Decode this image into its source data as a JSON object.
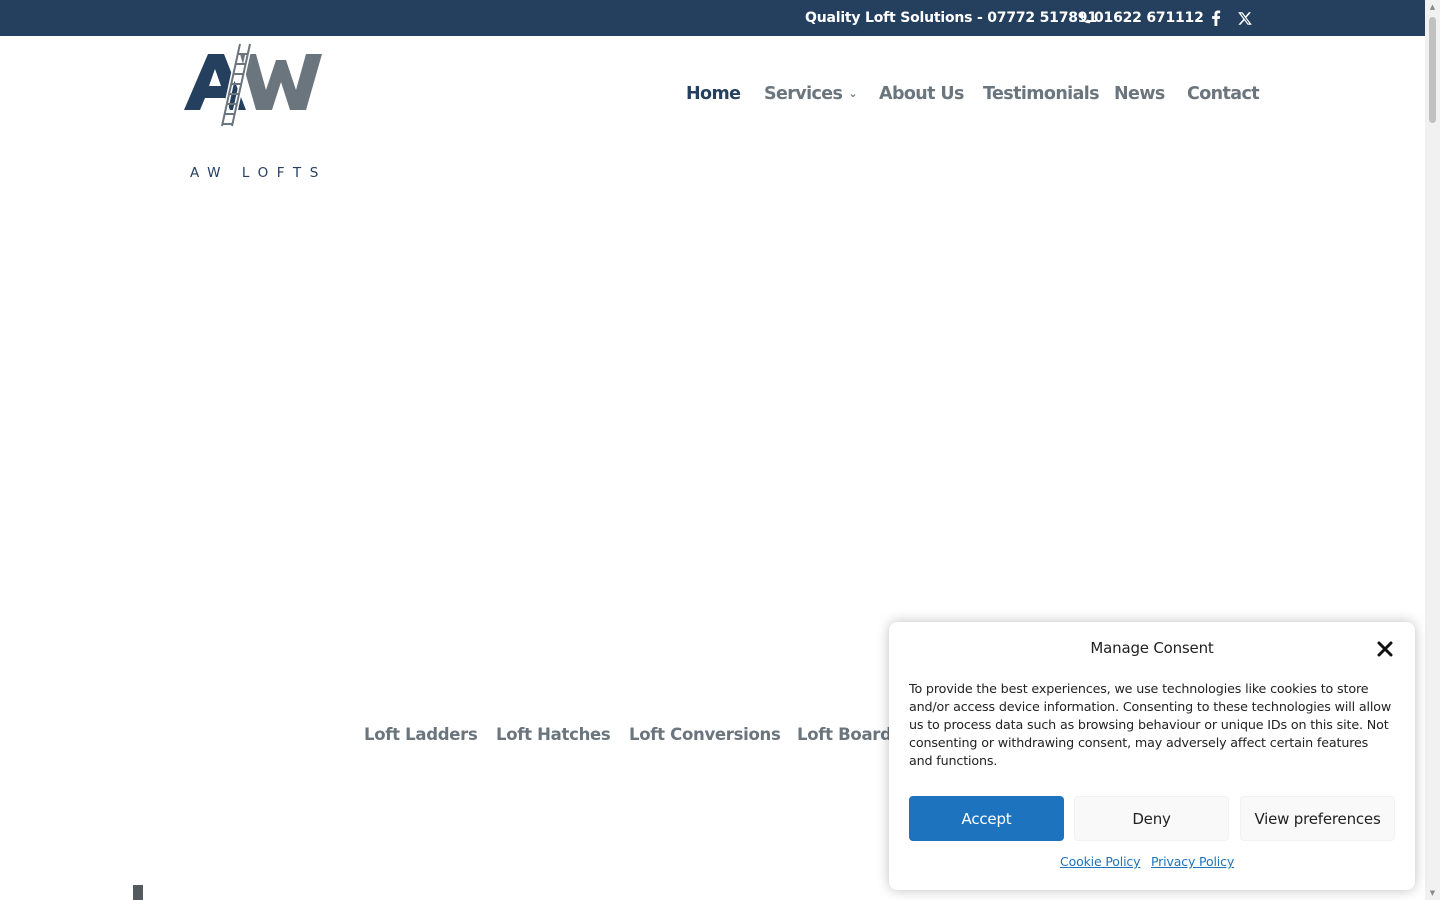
{
  "topbar": {
    "tagline": "Quality Loft Solutions - 07772 517891",
    "phone": "01622 671112",
    "social": [
      "facebook-icon",
      "x-twitter-icon"
    ]
  },
  "logo": {
    "text": "AW LOFTS"
  },
  "nav": {
    "home": "Home",
    "services": "Services",
    "about": "About Us",
    "testimonials": "Testimonials",
    "news": "News",
    "contact": "Contact"
  },
  "service_links": [
    "Loft Ladders",
    "Loft Hatches",
    "Loft Conversions",
    "Loft Board"
  ],
  "consent": {
    "title": "Manage Consent",
    "body": "To provide the best experiences, we use technologies like cookies to store and/or access device information. Consenting to these technologies will allow us to process data such as browsing behaviour or unique IDs on this site. Not consenting or withdrawing consent, may adversely affect certain features and functions.",
    "accept": "Accept",
    "deny": "Deny",
    "preferences": "View preferences",
    "cookie_policy": "Cookie Policy",
    "privacy_policy": "Privacy Policy"
  },
  "colors": {
    "topbar": "#25405f",
    "nav_active": "#25405f",
    "nav": "#6b757e",
    "accept_button": "#1e73be"
  }
}
